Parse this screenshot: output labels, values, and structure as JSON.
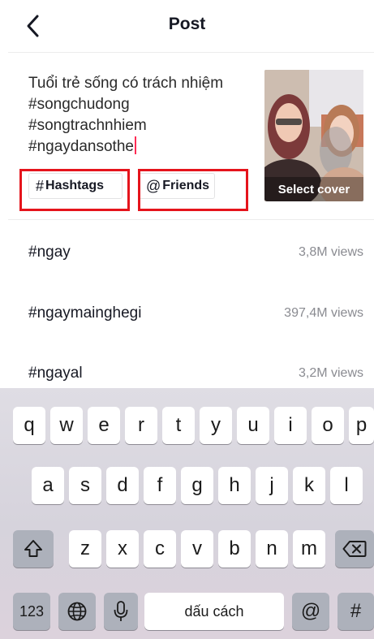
{
  "header": {
    "title": "Post"
  },
  "compose": {
    "caption_lines": [
      "Tuổi trẻ sống có trách nhiệm",
      "#songchudong",
      "#songtrachnhiem",
      "#ngaydansothe"
    ],
    "hashtags_label": "Hashtags",
    "friends_label": "Friends",
    "cover_label": "Select cover"
  },
  "suggestions": [
    {
      "tag": "#ngay",
      "views": "3,8M views"
    },
    {
      "tag": "#ngaymainghegi",
      "views": "397,4M views"
    },
    {
      "tag": "#ngayal",
      "views": "3,2M views"
    }
  ],
  "keyboard": {
    "row1": [
      "q",
      "w",
      "e",
      "r",
      "t",
      "y",
      "u",
      "i",
      "o",
      "p"
    ],
    "row2": [
      "a",
      "s",
      "d",
      "f",
      "g",
      "h",
      "j",
      "k",
      "l"
    ],
    "row3": [
      "z",
      "x",
      "c",
      "v",
      "b",
      "n",
      "m"
    ],
    "numbers_label": "123",
    "space_label": "dấu cách",
    "at_label": "@",
    "hash_label": "#"
  },
  "colors": {
    "accent": "#fe2c55",
    "highlight_box": "#e5141c",
    "muted_text": "#8a8b91"
  },
  "icons": [
    "back-chevron-icon",
    "hash-icon",
    "at-icon",
    "shift-icon",
    "backspace-icon",
    "globe-icon",
    "microphone-icon"
  ]
}
